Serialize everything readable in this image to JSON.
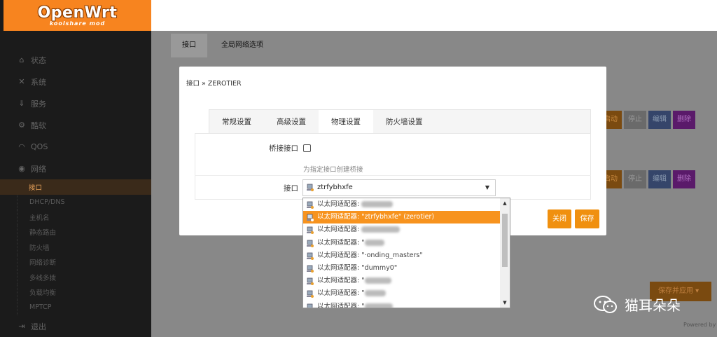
{
  "brand": {
    "title": "OpenWrt",
    "subtitle": "koolshare mod"
  },
  "sidebar": {
    "items": [
      {
        "label": "状态",
        "icon": "home-icon"
      },
      {
        "label": "系统",
        "icon": "tools-icon"
      },
      {
        "label": "服务",
        "icon": "download-icon"
      },
      {
        "label": "酷软",
        "icon": "gears-icon"
      },
      {
        "label": "QOS",
        "icon": "gauge-icon"
      },
      {
        "label": "网络",
        "icon": "globe-icon"
      }
    ],
    "subitems": [
      "接口",
      "DHCP/DNS",
      "主机名",
      "静态路由",
      "防火墙",
      "网络诊断",
      "多线多拨",
      "负载均衡",
      "MPTCP"
    ],
    "logout": "退出"
  },
  "main": {
    "tabs": [
      "接口",
      "全局网络选项"
    ],
    "row_buttons": {
      "connect": "启动",
      "stop": "停止",
      "edit": "编辑",
      "delete": "删除"
    },
    "save_apply": "保存并应用",
    "powered": "Powered by"
  },
  "modal": {
    "breadcrumb": "接口 » ZEROTIER",
    "tabs": [
      "常规设置",
      "高级设置",
      "物理设置",
      "防火墙设置"
    ],
    "active_tab": "物理设置",
    "bridge_label": "桥接接口",
    "bridge_hint": "为指定接口创建桥接",
    "iface_label": "接口",
    "iface_value": "ztrfybhxfe",
    "close_button": "关闭",
    "save_button": "保存"
  },
  "dropdown": {
    "prefix": "以太网适配器:",
    "items": [
      {
        "text": "",
        "selected": false
      },
      {
        "text": "\"ztrfybhxfe\" (zerotier)",
        "selected": true
      },
      {
        "text": "",
        "selected": false
      },
      {
        "text": "\"",
        "selected": false
      },
      {
        "text": "\"·onding_masters\"",
        "selected": false
      },
      {
        "text": "\"dummy0\"",
        "selected": false
      },
      {
        "text": "\"",
        "selected": false
      },
      {
        "text": "\"",
        "selected": false
      },
      {
        "text": "\"",
        "selected": false
      }
    ]
  },
  "watermark": "猫耳朵朵",
  "colors": {
    "accent": "#f7931e",
    "sidebar": "#1b1b1b"
  }
}
